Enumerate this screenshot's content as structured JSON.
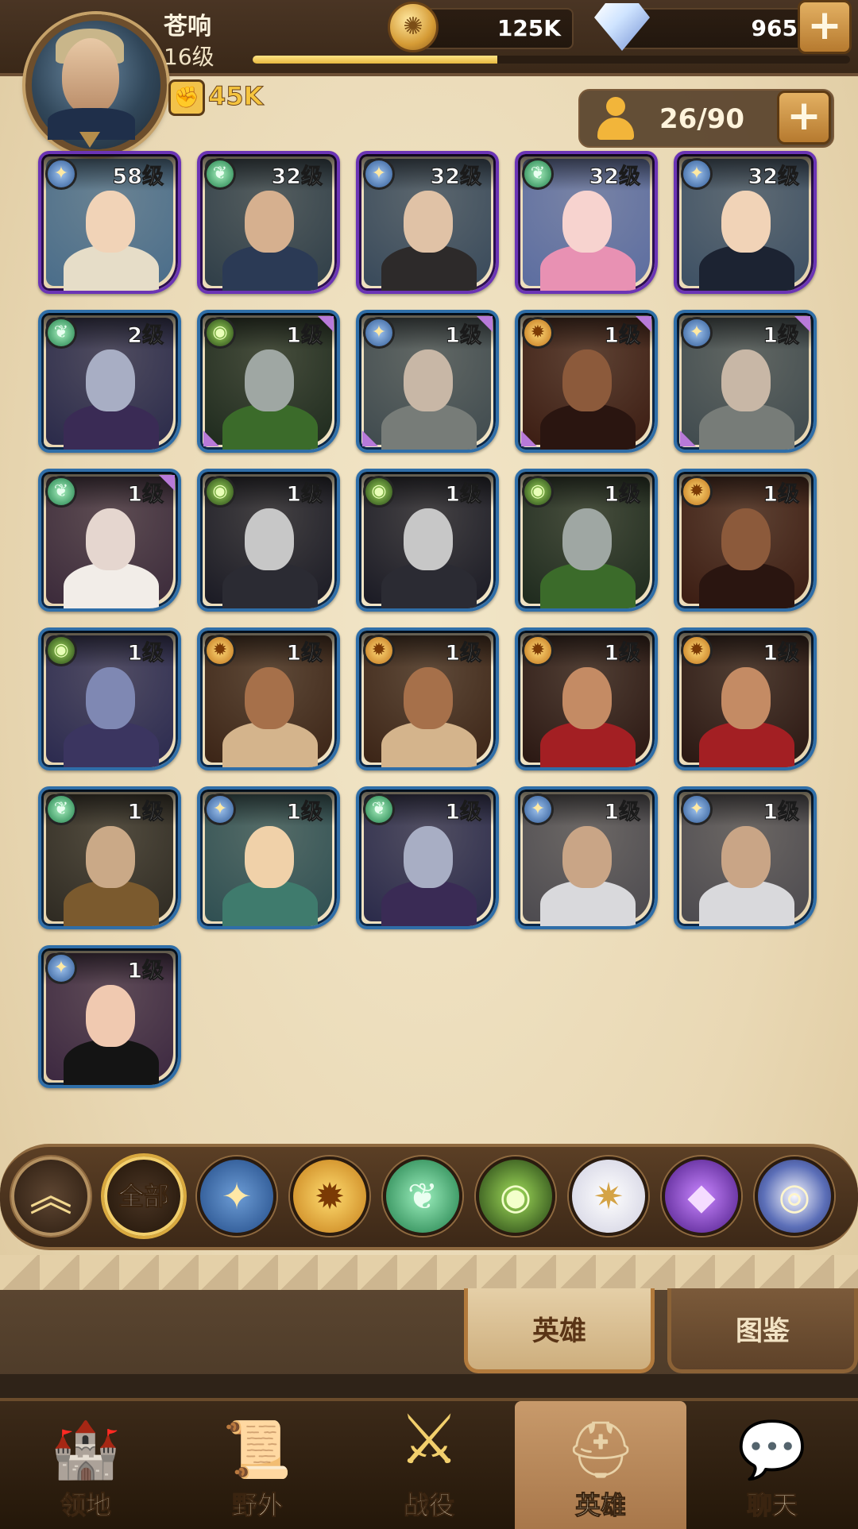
{
  "player": {
    "name": "苍响",
    "level": "16级",
    "power": "45K",
    "xp_fraction": 0.41
  },
  "currency": {
    "gold": "125K",
    "diamonds": "965"
  },
  "hero_capacity": "26/90",
  "heroes": [
    {
      "level": "58级",
      "faction": "light",
      "rarity": "elite",
      "palette": "blonde"
    },
    {
      "level": "32级",
      "faction": "nature",
      "rarity": "elite",
      "palette": "elf"
    },
    {
      "level": "32级",
      "faction": "light",
      "rarity": "elite",
      "palette": "warrior"
    },
    {
      "level": "32级",
      "faction": "nature",
      "rarity": "elite",
      "palette": "pink"
    },
    {
      "level": "32级",
      "faction": "light",
      "rarity": "elite",
      "palette": "maid"
    },
    {
      "level": "2级",
      "faction": "nature",
      "rarity": "rare",
      "palette": "hood"
    },
    {
      "level": "1级",
      "faction": "dark",
      "rarity": "rare",
      "palette": "ghoul"
    },
    {
      "level": "1级",
      "faction": "light",
      "rarity": "rare",
      "palette": "oldman"
    },
    {
      "level": "1级",
      "faction": "fire",
      "rarity": "rare",
      "palette": "wolf"
    },
    {
      "level": "1级",
      "faction": "light",
      "rarity": "rare",
      "palette": "oldman"
    },
    {
      "level": "1级",
      "faction": "nature",
      "rarity": "rare",
      "palette": "goat"
    },
    {
      "level": "1级",
      "faction": "dark",
      "rarity": "rare",
      "palette": "pale"
    },
    {
      "level": "1级",
      "faction": "dark",
      "rarity": "rare",
      "palette": "pale"
    },
    {
      "level": "1级",
      "faction": "dark",
      "rarity": "rare",
      "palette": "ghoul"
    },
    {
      "level": "1级",
      "faction": "fire",
      "rarity": "rare",
      "palette": "wolf"
    },
    {
      "level": "1级",
      "faction": "dark",
      "rarity": "rare",
      "palette": "purple"
    },
    {
      "level": "1级",
      "faction": "fire",
      "rarity": "rare",
      "palette": "tribal"
    },
    {
      "level": "1级",
      "faction": "fire",
      "rarity": "rare",
      "palette": "tribal"
    },
    {
      "level": "1级",
      "faction": "fire",
      "rarity": "rare",
      "palette": "dancer"
    },
    {
      "level": "1级",
      "faction": "fire",
      "rarity": "rare",
      "palette": "dancer"
    },
    {
      "level": "1级",
      "faction": "nature",
      "rarity": "rare",
      "palette": "shaman"
    },
    {
      "level": "1级",
      "faction": "light",
      "rarity": "rare",
      "palette": "ranger"
    },
    {
      "level": "1级",
      "faction": "nature",
      "rarity": "rare",
      "palette": "hood"
    },
    {
      "level": "1级",
      "faction": "light",
      "rarity": "rare",
      "palette": "knight"
    },
    {
      "level": "1级",
      "faction": "light",
      "rarity": "rare",
      "palette": "knight"
    },
    {
      "level": "1级",
      "faction": "light",
      "rarity": "rare",
      "palette": "witch"
    }
  ],
  "faction_filters": [
    {
      "name": "collapse-icon",
      "label": "",
      "active": false
    },
    {
      "name": "all",
      "label": "全部",
      "active": true
    },
    {
      "name": "light-faction-icon",
      "label": "",
      "active": false
    },
    {
      "name": "fire-faction-icon",
      "label": "",
      "active": false
    },
    {
      "name": "nature-faction-icon",
      "label": "",
      "active": false
    },
    {
      "name": "dark-faction-icon",
      "label": "",
      "active": false
    },
    {
      "name": "holy-faction-icon",
      "label": "",
      "active": false
    },
    {
      "name": "void-faction-icon",
      "label": "",
      "active": false
    },
    {
      "name": "celestial-faction-icon",
      "label": "",
      "active": false
    }
  ],
  "sub_tabs": [
    {
      "label": "英雄",
      "active": true
    },
    {
      "label": "图鉴",
      "active": false
    }
  ],
  "nav": [
    {
      "label": "领地",
      "icon": "castle-icon",
      "active": false
    },
    {
      "label": "野外",
      "icon": "map-scroll-icon",
      "active": false
    },
    {
      "label": "战役",
      "icon": "battle-sword-icon",
      "active": false
    },
    {
      "label": "英雄",
      "icon": "helmet-icon",
      "active": true
    },
    {
      "label": "聊天",
      "icon": "chat-icon",
      "active": false
    }
  ]
}
